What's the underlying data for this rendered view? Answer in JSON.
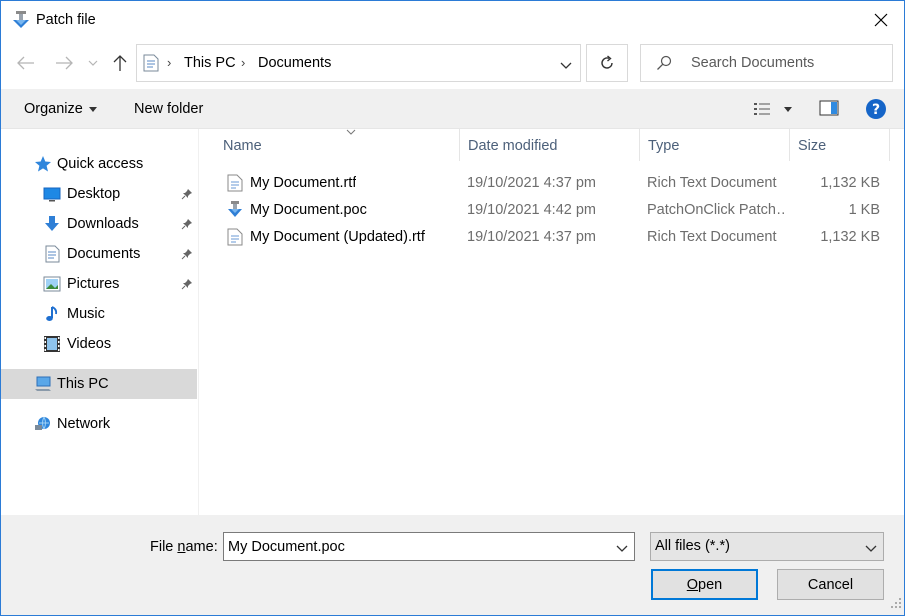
{
  "window": {
    "title": "Patch file"
  },
  "address": {
    "crumbs": [
      "This PC",
      "Documents"
    ]
  },
  "search": {
    "placeholder": "Search Documents"
  },
  "toolbar": {
    "organize_label": "Organize",
    "new_folder_label": "New folder"
  },
  "sidebar": {
    "items": [
      {
        "label": "Quick access",
        "icon": "star-icon"
      },
      {
        "label": "Desktop",
        "icon": "desktop-icon",
        "pinned": true
      },
      {
        "label": "Downloads",
        "icon": "download-icon",
        "pinned": true
      },
      {
        "label": "Documents",
        "icon": "documents-icon",
        "pinned": true
      },
      {
        "label": "Pictures",
        "icon": "pictures-icon",
        "pinned": true
      },
      {
        "label": "Music",
        "icon": "music-icon"
      },
      {
        "label": "Videos",
        "icon": "videos-icon"
      },
      {
        "label": "This PC",
        "icon": "computer-icon",
        "selected": true
      },
      {
        "label": "Network",
        "icon": "network-icon"
      }
    ]
  },
  "filelist": {
    "columns": [
      "Name",
      "Date modified",
      "Type",
      "Size"
    ],
    "rows": [
      {
        "name": "My Document.rtf",
        "date": "19/10/2021 4:37 pm",
        "type": "Rich Text Document",
        "size": "1,132 KB",
        "icon": "rtf-file-icon"
      },
      {
        "name": "My Document.poc",
        "date": "19/10/2021 4:42 pm",
        "type": "PatchOnClick Patch…",
        "size": "1 KB",
        "icon": "patch-file-icon"
      },
      {
        "name": "My Document (Updated).rtf",
        "date": "19/10/2021 4:37 pm",
        "type": "Rich Text Document",
        "size": "1,132 KB",
        "icon": "rtf-file-icon"
      }
    ]
  },
  "bottom": {
    "file_name_label_pre": "File ",
    "file_name_label_u": "n",
    "file_name_label_post": "ame:",
    "file_name_value": "My Document.poc",
    "filter_value": "All files (*.*)",
    "open_u": "O",
    "open_rest": "pen",
    "cancel_label": "Cancel"
  },
  "colors": {
    "accent": "#0078d7",
    "header_text": "#4c607a",
    "selected_bg": "#d9d9d9"
  }
}
